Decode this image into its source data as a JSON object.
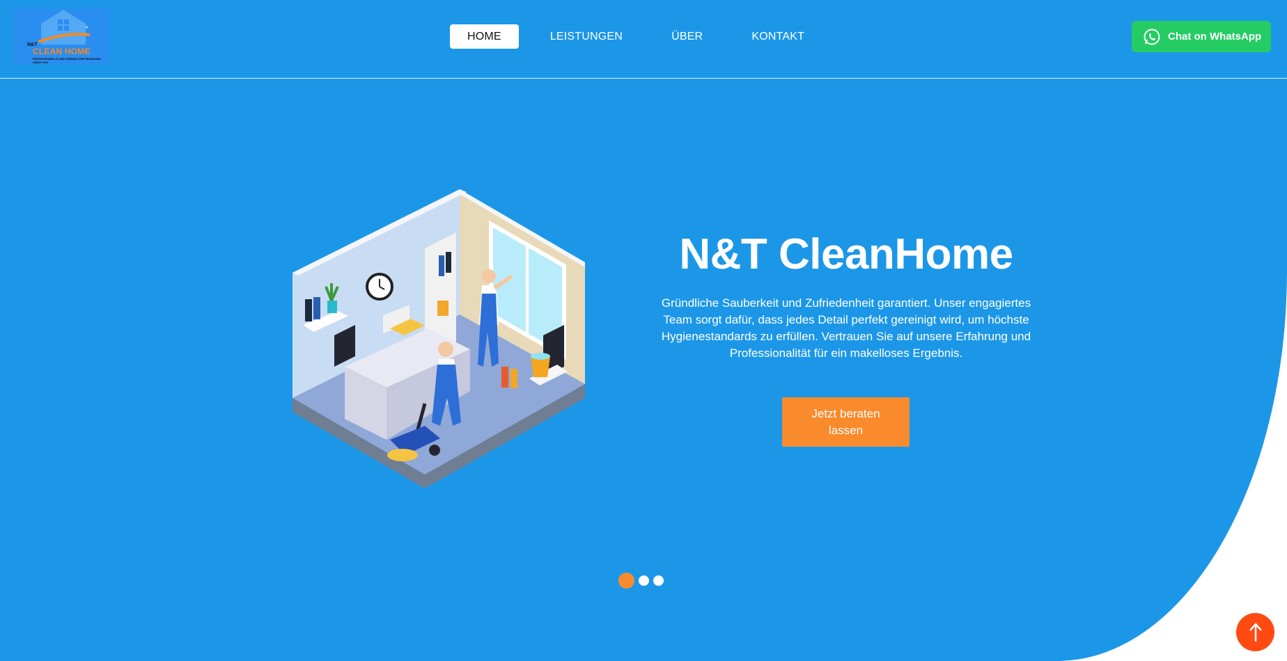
{
  "logo": {
    "small_text": "N&T",
    "brand_text": "CLEAN HOME",
    "tagline": "PROFESSIONELLE UND GRÜNDLICHE REINIGUNG",
    "since": "SINCE 2014"
  },
  "nav": {
    "items": [
      {
        "label": "HOME",
        "active": true
      },
      {
        "label": "LEISTUNGEN",
        "active": false
      },
      {
        "label": "ÜBER",
        "active": false
      },
      {
        "label": "KONTAKT",
        "active": false
      }
    ]
  },
  "whatsapp": {
    "label": "Chat on WhatsApp",
    "color": "#25cc63"
  },
  "hero": {
    "title": "N&T CleanHome",
    "description": "Gründliche Sauberkeit und Zufriedenheit garantiert. Unser engagiertes Team sorgt dafür, dass jedes Detail perfekt gereinigt wird, um höchste Hygienestandards zu erfüllen. Vertrauen Sie auf unsere Erfahrung und Professionalität für ein makelloses Ergebnis.",
    "cta_label": "Jetzt beraten lassen",
    "slides_count": 3,
    "active_slide": 1
  },
  "scroll_top": {
    "icon": "arrow-up-icon",
    "color": "#ff4a12"
  },
  "colors": {
    "primary": "#1c97e8",
    "accent": "#f98b2d",
    "whatsapp": "#25cc63"
  }
}
